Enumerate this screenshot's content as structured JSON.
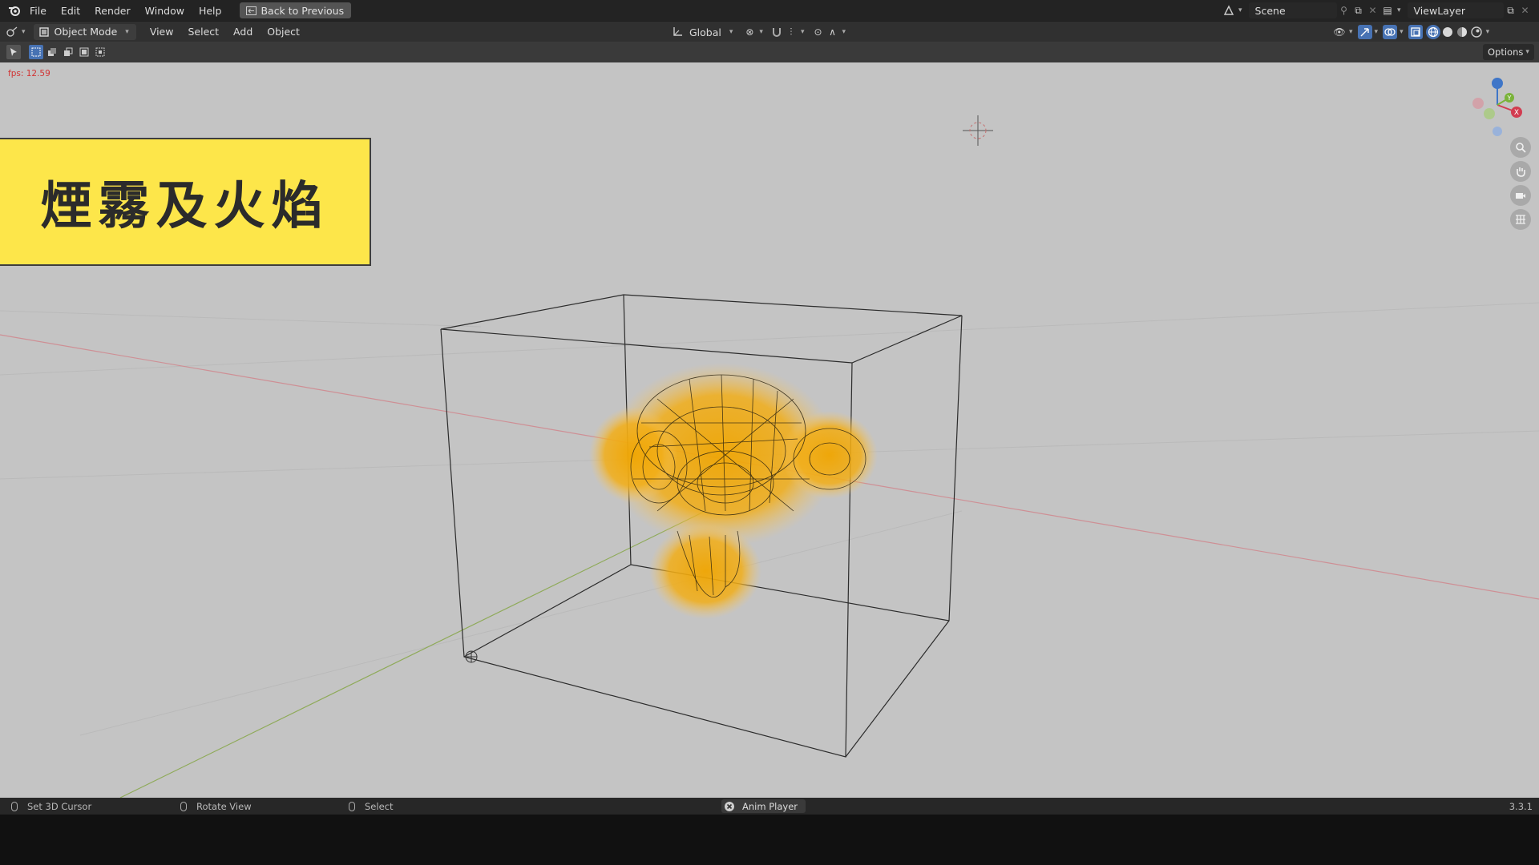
{
  "topbar": {
    "menus": [
      "File",
      "Edit",
      "Render",
      "Window",
      "Help"
    ],
    "back_button": "Back to Previous",
    "scene": "Scene",
    "view_layer": "ViewLayer"
  },
  "header": {
    "mode": "Object Mode",
    "menus": [
      "View",
      "Select",
      "Add",
      "Object"
    ],
    "orientation": "Global"
  },
  "toolheader": {
    "options": "Options"
  },
  "viewport": {
    "fps": "fps: 12.59",
    "banner_text": "煙霧及火焰",
    "gizmo": {
      "y": "Y",
      "x": "X"
    },
    "nav_icons": [
      "zoom-icon",
      "hand-pan-icon",
      "camera-icon",
      "grid-perspective-icon"
    ]
  },
  "statusbar": {
    "set_cursor": "Set 3D Cursor",
    "rotate_view": "Rotate View",
    "select": "Select",
    "anim_player": "Anim Player",
    "version": "3.3.1"
  },
  "colors": {
    "viewport_bg": "#c4c4c4",
    "banner_bg": "#fde64a",
    "fire_glow": "#f0a500",
    "x_axis": "#d23c50",
    "y_axis": "#7ab33a",
    "z_axis": "#3f76c8",
    "fps_text": "#d13434"
  }
}
